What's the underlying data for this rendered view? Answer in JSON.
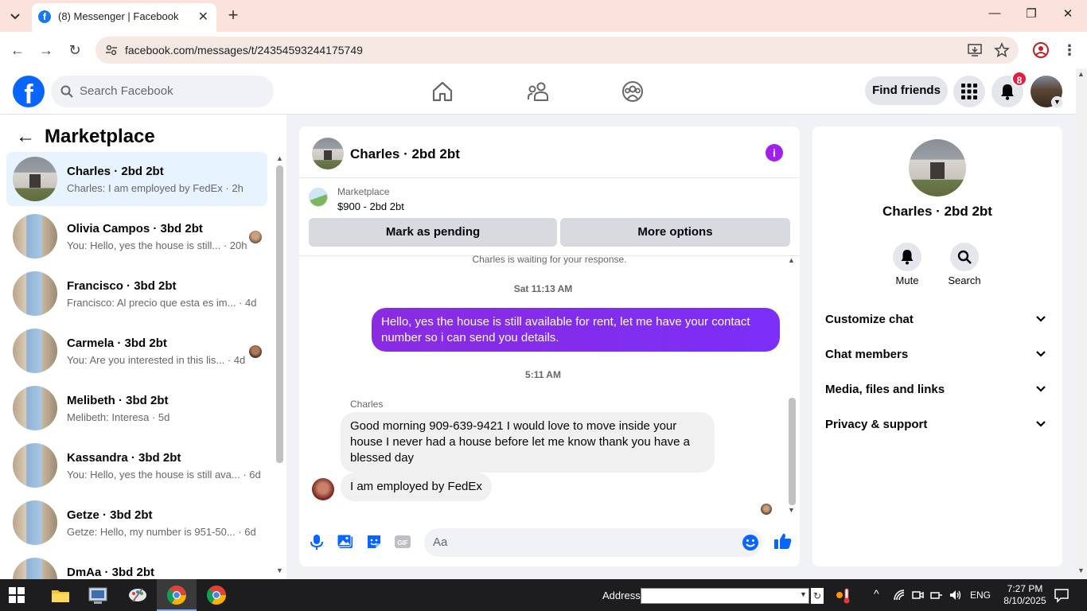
{
  "browser": {
    "tab_title": "(8) Messenger | Facebook",
    "url": "facebook.com/messages/t/24354593244175749"
  },
  "fb_header": {
    "search_placeholder": "Search Facebook",
    "find_friends": "Find friends",
    "notification_count": "8"
  },
  "left": {
    "title": "Marketplace",
    "conversations": [
      {
        "name": "Charles · 2bd 2bt",
        "preview": "Charles: I am employed by FedEx · 2h",
        "active": true
      },
      {
        "name": "Olivia Campos · 3bd 2bt",
        "preview": "You: Hello, yes the house is still... · 20h"
      },
      {
        "name": "Francisco · 3bd 2bt",
        "preview": "Francisco: Al precio que esta es im... · 4d"
      },
      {
        "name": "Carmela · 3bd 2bt",
        "preview": "You: Are you interested in this lis... · 4d"
      },
      {
        "name": "Melibeth · 3bd 2bt",
        "preview": "Melibeth: Interesa · 5d"
      },
      {
        "name": "Kassandra · 3bd 2bt",
        "preview": "You: Hello, yes the house is still ava... · 6d"
      },
      {
        "name": "Getze · 3bd 2bt",
        "preview": "Getze: Hello, my number is 951-50... · 6d"
      },
      {
        "name": "DmAa · 3bd 2bt",
        "preview": ""
      }
    ]
  },
  "chat": {
    "title": "Charles · 2bd 2bt",
    "marketplace_label": "Marketplace",
    "listing": "$900 - 2bd 2bt",
    "mark_pending": "Mark as pending",
    "more_options": "More options",
    "waiting": "Charles is waiting for your response.",
    "ts1": "Sat 11:13 AM",
    "outgoing": "Hello, yes the house is still available for rent, let me have your contact number so i can send you details.",
    "ts2": "5:11 AM",
    "sender": "Charles",
    "incoming1": "Good morning 909-639-9421 I would love to move inside your house I never had a house before let me know thank you have a blessed day",
    "incoming2": "I am employed by FedEx",
    "composer_placeholder": "Aa"
  },
  "right": {
    "name": "Charles · 2bd 2bt",
    "mute": "Mute",
    "search": "Search",
    "sections": [
      "Customize chat",
      "Chat members",
      "Media, files and links",
      "Privacy & support"
    ]
  },
  "taskbar": {
    "address_label": "Address",
    "lang": "ENG",
    "time": "7:27 PM",
    "date": "8/10/2025"
  },
  "colors": {
    "fb_blue": "#0866ff",
    "messenger_purple": "#8a2be2",
    "active_row": "#e7f3ff",
    "badge_red": "#e41e3f"
  }
}
